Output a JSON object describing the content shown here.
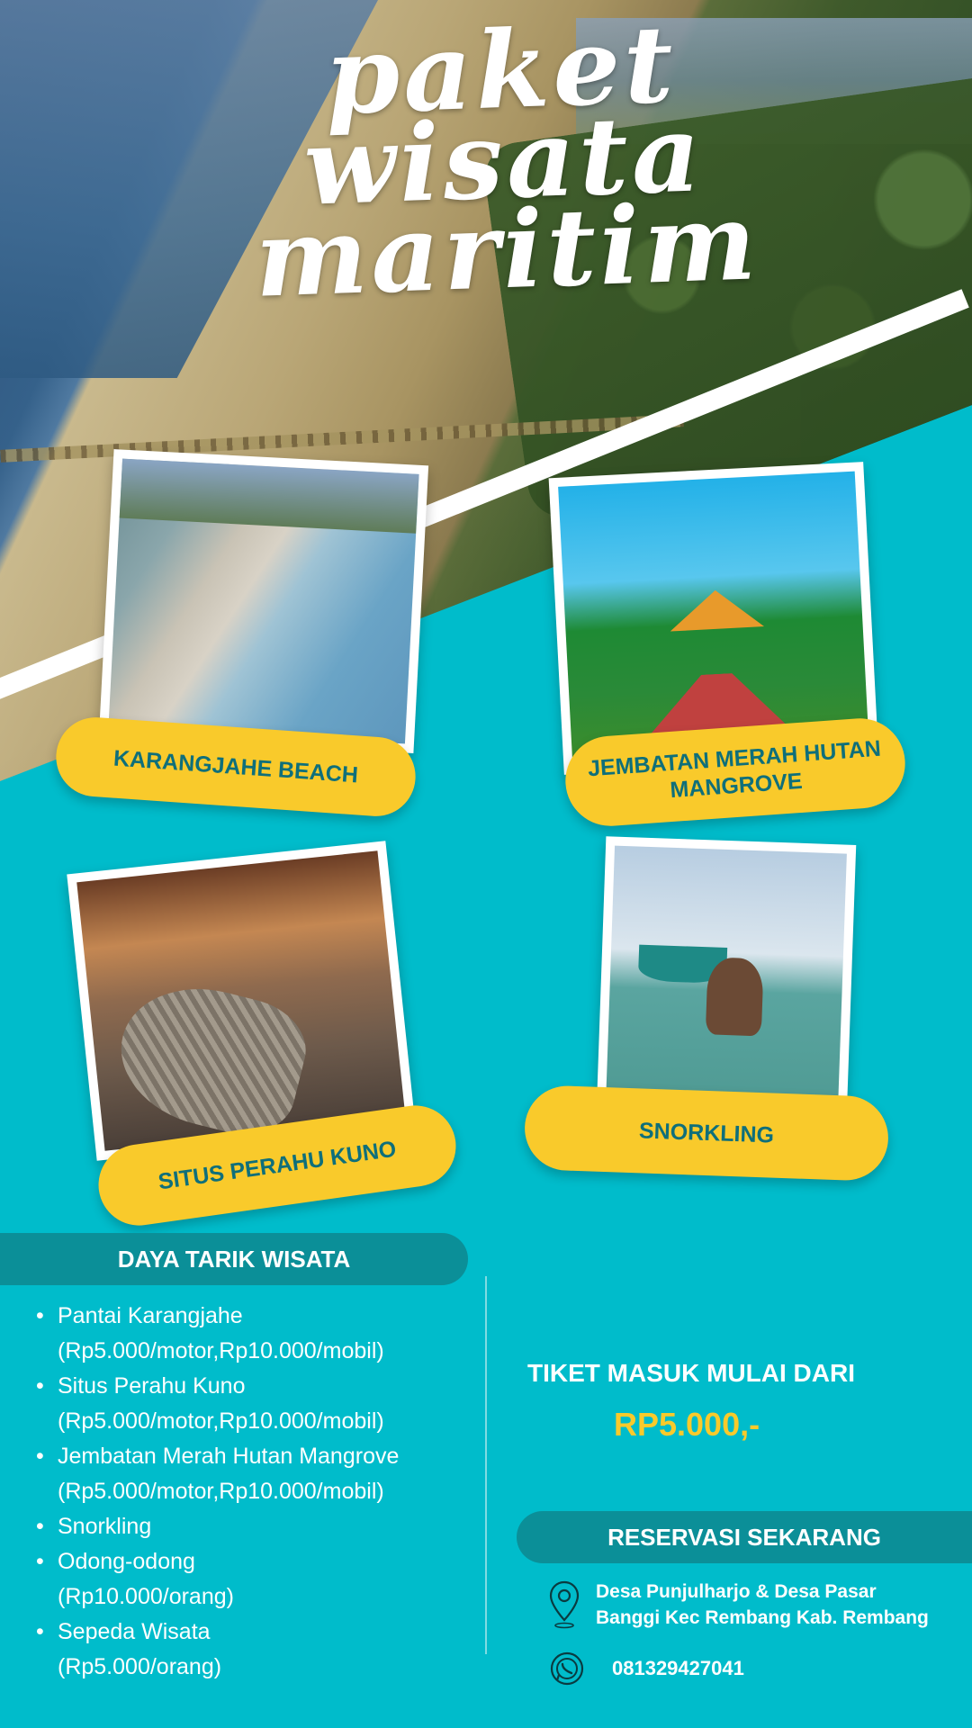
{
  "hero": {
    "title_line1": "paket wisata",
    "title_line2": "maritim"
  },
  "cards": [
    {
      "label": "KARANGJAHE BEACH"
    },
    {
      "label": "JEMBATAN MERAH HUTAN MANGROVE"
    },
    {
      "label": "SITUS PERAHU KUNO"
    },
    {
      "label": "SNORKLING"
    }
  ],
  "daya_tarik": {
    "heading": "DAYA TARIK WISATA",
    "items": [
      {
        "name": "Pantai Karangjahe",
        "price": "(Rp5.000/motor,Rp10.000/mobil)"
      },
      {
        "name": "Situs Perahu Kuno",
        "price": "(Rp5.000/motor,Rp10.000/mobil)"
      },
      {
        "name": "Jembatan Merah Hutan Mangrove",
        "price": "(Rp5.000/motor,Rp10.000/mobil)"
      },
      {
        "name": "Snorkling",
        "price": ""
      },
      {
        "name": "Odong-odong",
        "price": "(Rp10.000/orang)"
      },
      {
        "name": "Sepeda Wisata",
        "price": "(Rp5.000/orang)"
      }
    ]
  },
  "tiket": {
    "label": "TIKET MASUK MULAI DARI",
    "price": "RP5.000,-"
  },
  "reservasi": {
    "heading": "RESERVASI SEKARANG",
    "address_line1": "Desa Punjulharjo & Desa Pasar",
    "address_line2": "Banggi Kec Rembang Kab. Rembang",
    "phone": "081329427041"
  },
  "icons": {
    "location": "location-pin-icon",
    "whatsapp": "whatsapp-icon"
  },
  "colors": {
    "background": "#00bccb",
    "pill": "#f9ca2b",
    "pill_text": "#0f6f7a",
    "bar": "#0b8f98",
    "price": "#f9ca2b"
  }
}
